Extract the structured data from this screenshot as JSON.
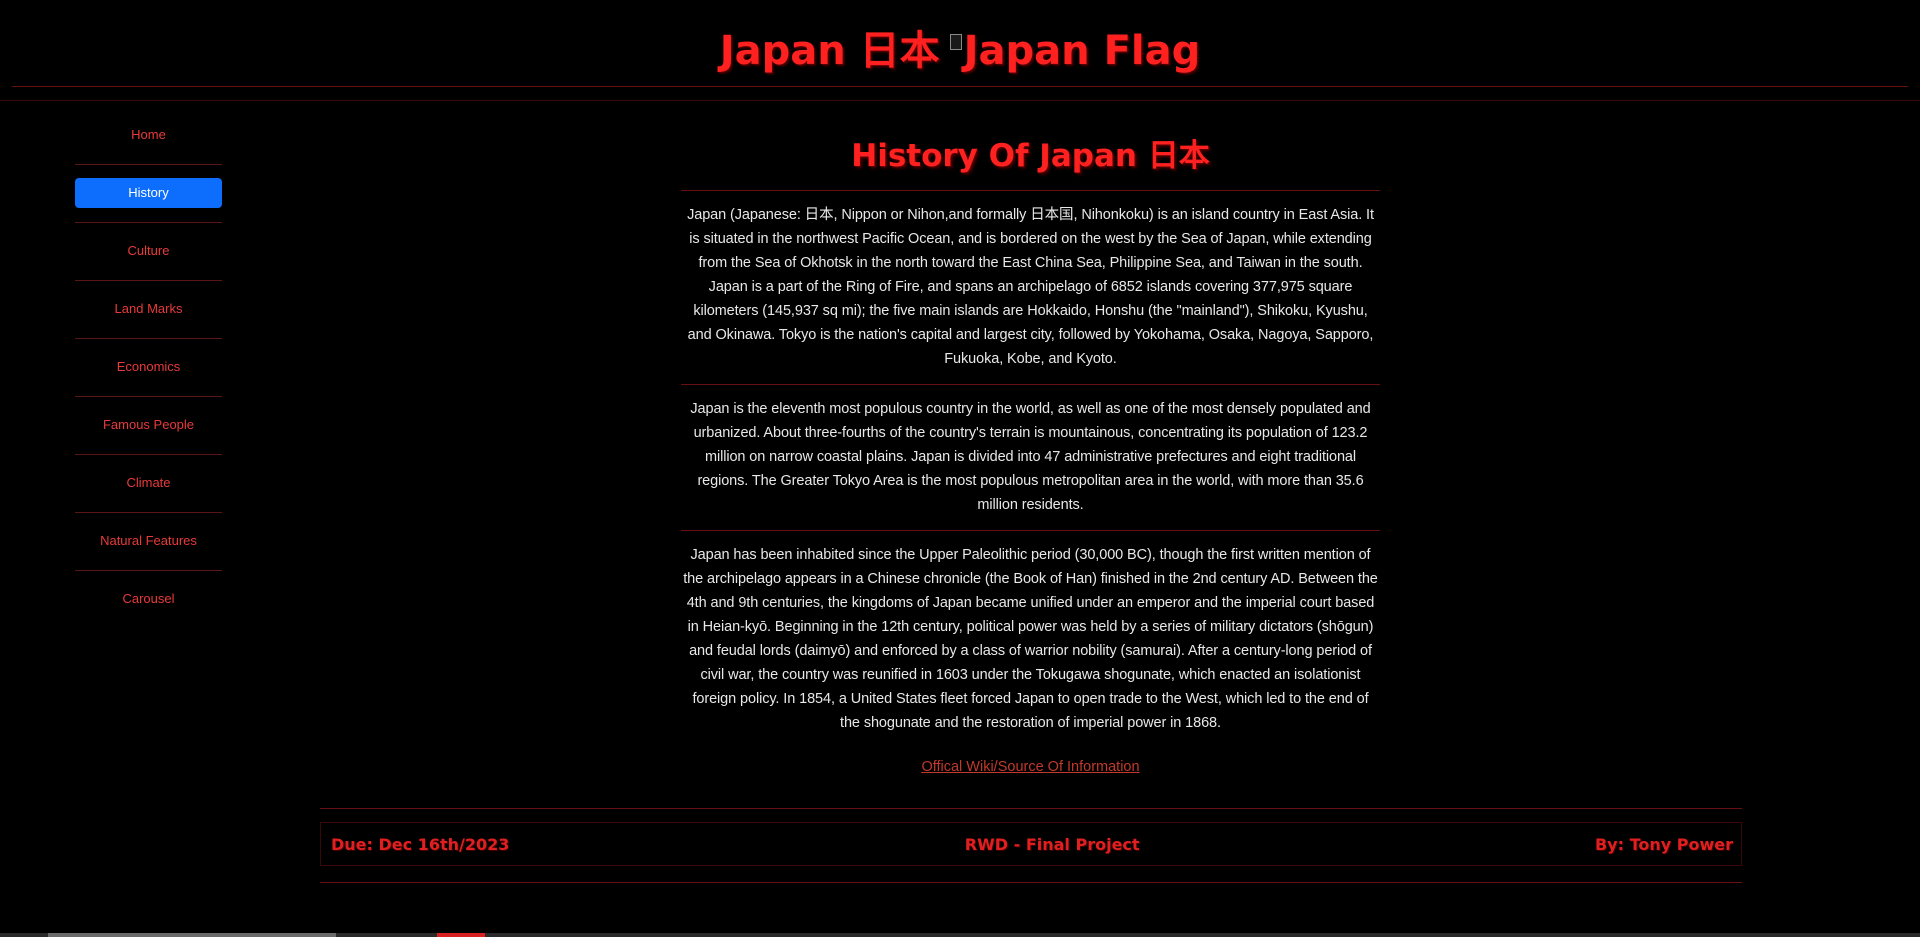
{
  "header": {
    "title": "Japan 日本",
    "flag_alt": "Japan Flag"
  },
  "sidebar": {
    "items": [
      {
        "label": "Home",
        "active": false
      },
      {
        "label": "History",
        "active": true
      },
      {
        "label": "Culture",
        "active": false
      },
      {
        "label": "Land Marks",
        "active": false
      },
      {
        "label": "Economics",
        "active": false
      },
      {
        "label": "Famous People",
        "active": false
      },
      {
        "label": "Climate",
        "active": false
      },
      {
        "label": "Natural Features",
        "active": false
      },
      {
        "label": "Carousel",
        "active": false
      }
    ]
  },
  "main": {
    "title": "History Of Japan 日本",
    "paragraphs": [
      "Japan (Japanese: 日本, Nippon or Nihon,and formally 日本国, Nihonkoku) is an island country in East Asia. It is situated in the northwest Pacific Ocean, and is bordered on the west by the Sea of Japan, while extending from the Sea of Okhotsk in the north toward the East China Sea, Philippine Sea, and Taiwan in the south. Japan is a part of the Ring of Fire, and spans an archipelago of 6852 islands covering 377,975 square kilometers (145,937 sq mi); the five main islands are Hokkaido, Honshu (the \"mainland\"), Shikoku, Kyushu, and Okinawa. Tokyo is the nation's capital and largest city, followed by Yokohama, Osaka, Nagoya, Sapporo, Fukuoka, Kobe, and Kyoto.",
      "Japan is the eleventh most populous country in the world, as well as one of the most densely populated and urbanized. About three-fourths of the country's terrain is mountainous, concentrating its population of 123.2 million on narrow coastal plains. Japan is divided into 47 administrative prefectures and eight traditional regions. The Greater Tokyo Area is the most populous metropolitan area in the world, with more than 35.6 million residents.",
      "Japan has been inhabited since the Upper Paleolithic period (30,000 BC), though the first written mention of the archipelago appears in a Chinese chronicle (the Book of Han) finished in the 2nd century AD. Between the 4th and 9th centuries, the kingdoms of Japan became unified under an emperor and the imperial court based in Heian-kyō. Beginning in the 12th century, political power was held by a series of military dictators (shōgun) and feudal lords (daimyō) and enforced by a class of warrior nobility (samurai). After a century-long period of civil war, the country was reunified in 1603 under the Tokugawa shogunate, which enacted an isolationist foreign policy. In 1854, a United States fleet forced Japan to open trade to the West, which led to the end of the shogunate and the restoration of imperial power in 1868."
    ],
    "source_link": "Offical Wiki/Source Of Information"
  },
  "footer": {
    "due": "Due: Dec 16th/2023",
    "project": "RWD - Final Project",
    "author": "By: Tony Power"
  },
  "colors": {
    "background": "#000000",
    "accent_red": "#ff2020",
    "active_nav": "#0d6efd",
    "divider": "#6a0f0f"
  }
}
